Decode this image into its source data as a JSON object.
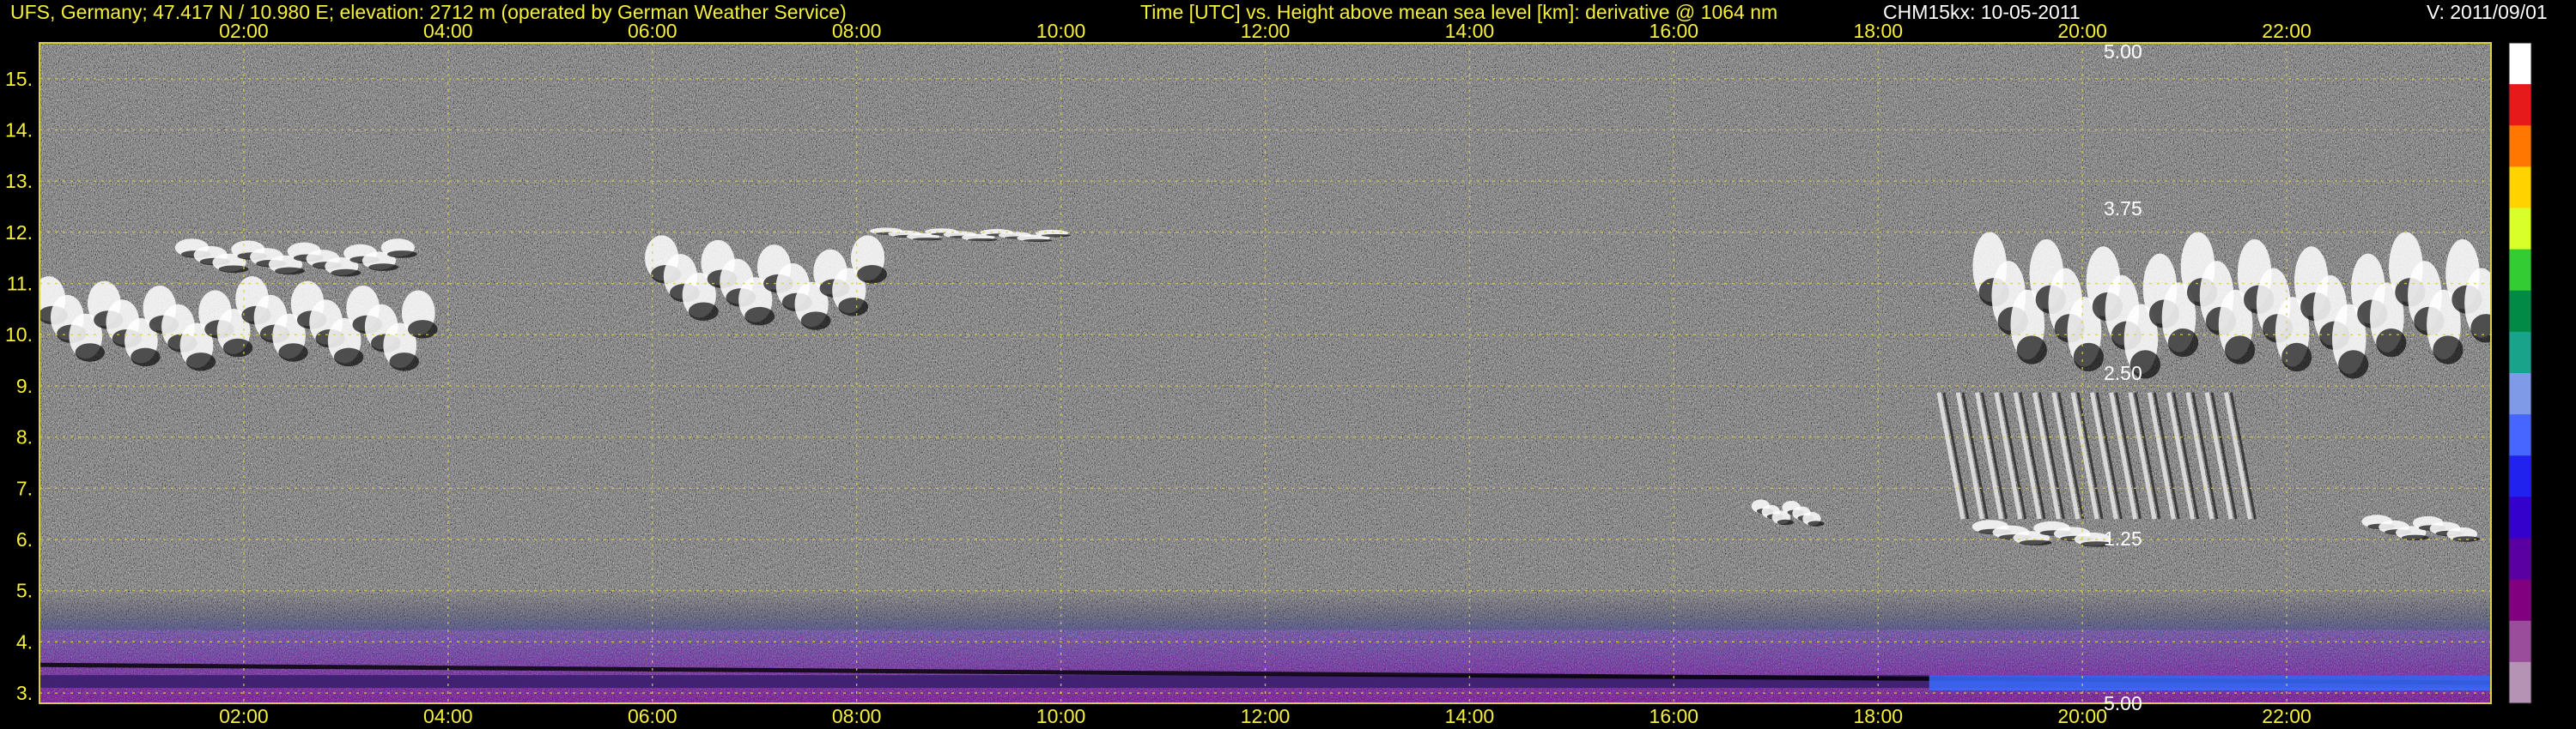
{
  "header": {
    "station": "UFS, Germany; 47.417 N / 10.980 E; elevation: 2712 m  (operated by German Weather Service)",
    "axis_desc": "Time [UTC] vs. Height above mean sea level [km]: derivative @ 1064 nm",
    "instrument": "CHM15kx: 10-05-2011",
    "version": "V: 2011/09/01"
  },
  "colorbar": {
    "labels": [
      "5.00",
      "3.75",
      "2.50",
      "1.25",
      "5.00"
    ],
    "colors": [
      "#ffffff",
      "#e61a1a",
      "#ff7700",
      "#ffd200",
      "#d8ff2a",
      "#33cc33",
      "#008a45",
      "#19a38a",
      "#7f9ae6",
      "#4666ff",
      "#2222ee",
      "#3300cc",
      "#5a00a3",
      "#800080",
      "#9a4d9a",
      "#b593b5"
    ]
  },
  "chart_data": {
    "type": "heatmap",
    "title": "Time [UTC] vs. Height above mean sea level [km]: derivative @ 1064 nm",
    "xlabel": "Time [UTC]",
    "ylabel": "Height above mean sea level [km]",
    "x_ticks": [
      "02:00",
      "04:00",
      "06:00",
      "08:00",
      "10:00",
      "12:00",
      "14:00",
      "16:00",
      "18:00",
      "20:00",
      "22:00"
    ],
    "x_tick_hours": [
      2,
      4,
      6,
      8,
      10,
      12,
      14,
      16,
      18,
      20,
      22
    ],
    "xlim": [
      0,
      24
    ],
    "y_ticks": [
      3,
      4,
      5,
      6,
      7,
      8,
      9,
      10,
      11,
      12,
      13,
      14,
      15
    ],
    "ylim": [
      2.8,
      15.7
    ],
    "grid": true,
    "colorbar_ticks": [
      "5.00",
      "3.75",
      "2.50",
      "1.25",
      "5.00"
    ],
    "features": [
      {
        "name": "cirrus-layer",
        "t_start": 0.0,
        "t_end": 3.8,
        "h_bottom": 9.2,
        "h_top": 11.2
      },
      {
        "name": "cirrus-layer",
        "t_start": 1.4,
        "t_end": 3.6,
        "h_bottom": 11.1,
        "h_top": 11.9
      },
      {
        "name": "cirrus-layer",
        "t_start": 6.0,
        "t_end": 8.2,
        "h_bottom": 10.0,
        "h_top": 12.0
      },
      {
        "name": "cirrus-layer",
        "t_start": 8.2,
        "t_end": 10.0,
        "h_bottom": 11.8,
        "h_top": 12.1
      },
      {
        "name": "cirrus-layer",
        "t_start": 19.0,
        "t_end": 24.0,
        "h_bottom": 9.0,
        "h_top": 12.1
      },
      {
        "name": "cloud-fall-streaks",
        "t_start": 18.5,
        "t_end": 21.5,
        "h_bottom": 6.4,
        "h_top": 9.0
      },
      {
        "name": "low-cloud",
        "t_start": 16.8,
        "t_end": 17.4,
        "h_bottom": 6.2,
        "h_top": 6.8
      },
      {
        "name": "low-cloud",
        "t_start": 19.0,
        "t_end": 20.2,
        "h_bottom": 5.8,
        "h_top": 6.4
      },
      {
        "name": "low-cloud",
        "t_start": 22.8,
        "t_end": 23.8,
        "h_bottom": 5.9,
        "h_top": 6.5
      },
      {
        "name": "boundary-layer",
        "t_start": 0.0,
        "t_end": 24.0,
        "h_bottom": 2.8,
        "h_top": 5.0
      }
    ]
  }
}
